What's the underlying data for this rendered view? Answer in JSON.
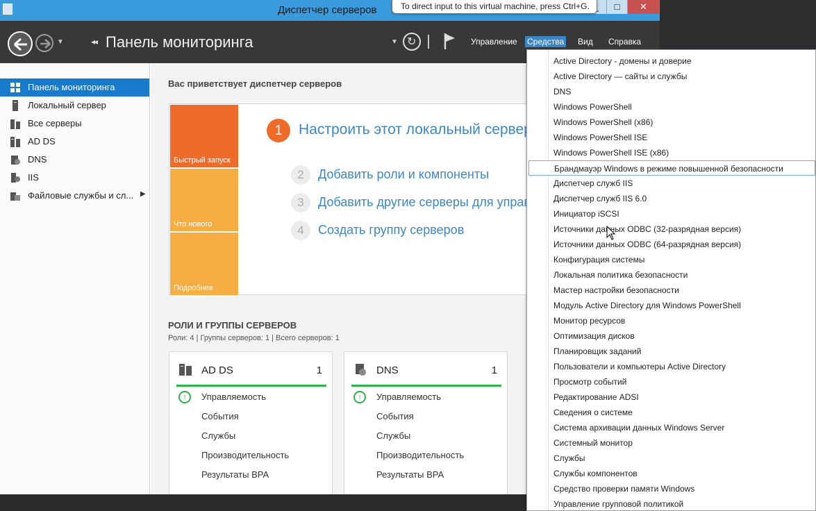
{
  "window": {
    "title": "Диспетчер серверов",
    "tooltip": "To direct input to this virtual machine, press Ctrl+G."
  },
  "header": {
    "title": "Панель мониторинга",
    "menus": [
      "Управление",
      "Средства",
      "Вид",
      "Справка"
    ]
  },
  "sidebar": {
    "items": [
      {
        "label": "Панель мониторинга",
        "icon": "dashboard-icon"
      },
      {
        "label": "Локальный сервер",
        "icon": "server-icon"
      },
      {
        "label": "Все серверы",
        "icon": "servers-icon"
      },
      {
        "label": "AD DS",
        "icon": "ad-ds-icon"
      },
      {
        "label": "DNS",
        "icon": "dns-icon"
      },
      {
        "label": "IIS",
        "icon": "iis-icon"
      },
      {
        "label": "Файловые службы и сл...",
        "icon": "file-services-icon"
      }
    ]
  },
  "main": {
    "welcome": "Вас приветствует диспетчер серверов",
    "tiles": [
      "Быстрый запуск",
      "Что нового",
      "Подробнее"
    ],
    "steps": [
      {
        "num": "1",
        "label": "Настроить этот локальный сервер"
      },
      {
        "num": "2",
        "label": "Добавить роли и компоненты"
      },
      {
        "num": "3",
        "label": "Добавить другие серверы для управления"
      },
      {
        "num": "4",
        "label": "Создать группу серверов"
      }
    ],
    "roles_heading": "РОЛИ И ГРУППЫ СЕРВЕРОВ",
    "roles_sub": "Роли: 4 | Группы серверов: 1 | Всего серверов: 1",
    "cards": [
      {
        "name": "AD DS",
        "count": "1",
        "rows": [
          "Управляемость",
          "События",
          "Службы",
          "Производительность",
          "Результаты BPA"
        ]
      },
      {
        "name": "DNS",
        "count": "1",
        "rows": [
          "Управляемость",
          "События",
          "Службы",
          "Производительность",
          "Результаты BPA"
        ]
      }
    ]
  },
  "tools_menu": {
    "items": [
      "Active Directory - домены и доверие",
      "Active Directory — сайты и службы",
      "DNS",
      "Windows PowerShell",
      "Windows PowerShell (x86)",
      "Windows PowerShell ISE",
      "Windows PowerShell ISE (x86)",
      "Брандмауэр Windows в режиме повышенной безопасности",
      "Диспетчер служб IIS",
      "Диспетчер служб IIS 6.0",
      "Инициатор iSCSI",
      "Источники данных ODBC (32-разрядная версия)",
      "Источники данных ODBC (64-разрядная версия)",
      "Конфигурация системы",
      "Локальная политика безопасности",
      "Мастер настройки безопасности",
      "Модуль Active Directory для Windows PowerShell",
      "Монитор ресурсов",
      "Оптимизация дисков",
      "Планировщик заданий",
      "Пользователи и компьютеры Active Directory",
      "Просмотр событий",
      "Редактирование ADSI",
      "Сведения о системе",
      "Система архивации данных Windows Server",
      "Системный монитор",
      "Службы",
      "Службы компонентов",
      "Средство проверки памяти Windows",
      "Управление групповой политикой"
    ],
    "highlighted": "Брандмауэр Windows в режиме повышенной безопасности"
  },
  "colors": {
    "accent": "#1979ca",
    "orange": "#ef6b2a",
    "yellow": "#f6ae43",
    "ok_green": "#2eb24a",
    "link_blue": "#3e86c5"
  }
}
